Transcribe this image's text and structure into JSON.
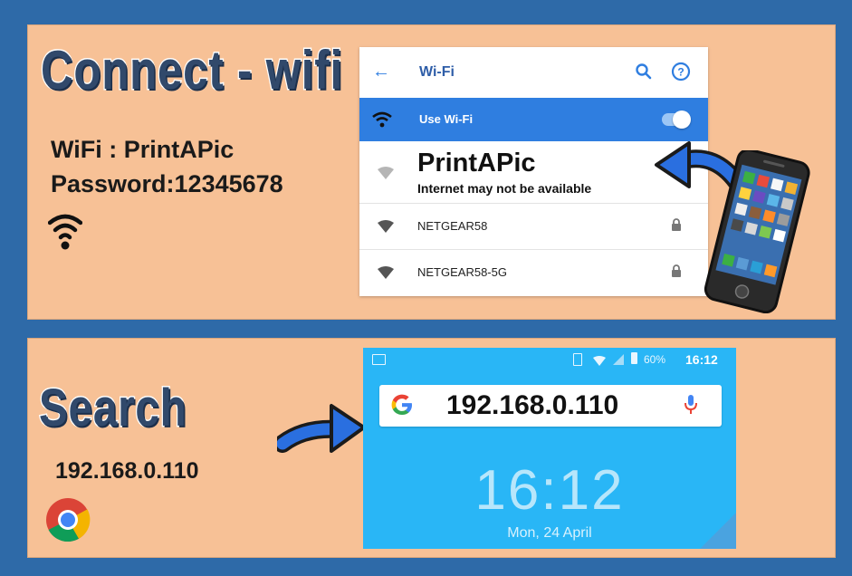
{
  "panel1": {
    "title": "Connect - wifi",
    "wifi_line": "WiFi : PrintAPic",
    "password_line": "Password:12345678",
    "icon": "wifi-icon",
    "screen": {
      "back_icon": "back-arrow-icon",
      "header": "Wi-Fi",
      "search_icon": "search-icon",
      "help_icon": "help-icon",
      "use_wifi_label": "Use Wi-Fi",
      "use_wifi_on": true,
      "networks": [
        {
          "name": "PrintAPic",
          "subtitle": "Internet may not be available",
          "locked": false
        },
        {
          "name": "NETGEAR58",
          "subtitle": "",
          "locked": true
        },
        {
          "name": "NETGEAR58-5G",
          "subtitle": "",
          "locked": true
        }
      ]
    },
    "arrow_icon": "curved-arrow-icon",
    "phone_icon": "smartphone-icon"
  },
  "panel2": {
    "title": "Search",
    "address": "192.168.0.110",
    "browser_icon": "chrome-icon",
    "arrow_icon": "arrow-right-icon",
    "screen": {
      "status_battery": "60%",
      "status_time": "16:12",
      "search_text": "192.168.0.110",
      "google_icon": "google-g-icon",
      "mic_icon": "mic-icon",
      "clock": "16:12",
      "date": "Mon, 24 April"
    }
  },
  "colors": {
    "background": "#2e6aa8",
    "panel": "#f7c196",
    "accent_blue": "#2f7ee0",
    "search_bg": "#29b6f6"
  }
}
